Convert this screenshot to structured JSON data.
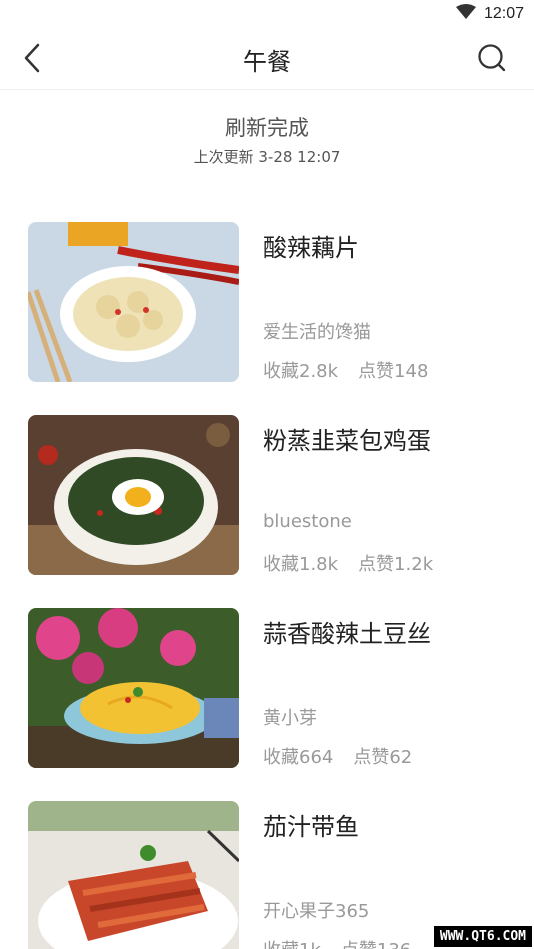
{
  "status_bar": {
    "time": "12:07",
    "wifi_icon": "wifi-icon"
  },
  "header": {
    "title": "午餐",
    "back_icon": "back-arrow-icon",
    "search_icon": "search-icon"
  },
  "refresh": {
    "title": "刷新完成",
    "subtitle": "上次更新 3-28 12:07"
  },
  "recipes": [
    {
      "title": "酸辣藕片",
      "author": "爱生活的馋猫",
      "favorites": "收藏2.8k",
      "likes": "点赞148"
    },
    {
      "title": "粉蒸韭菜包鸡蛋",
      "author": "bluestone",
      "favorites": "收藏1.8k",
      "likes": "点赞1.2k"
    },
    {
      "title": "蒜香酸辣土豆丝",
      "author": "黄小芽",
      "favorites": "收藏664",
      "likes": "点赞62"
    },
    {
      "title": "茄汁带鱼",
      "author": "开心果子365",
      "favorites": "收藏1k",
      "likes": "点赞136"
    }
  ],
  "watermark": "WWW.QT6.COM"
}
